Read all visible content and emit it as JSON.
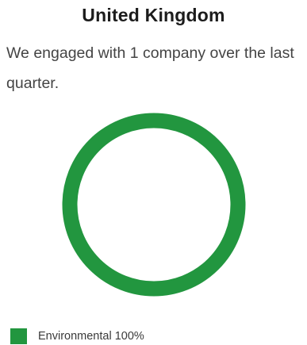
{
  "header": {
    "title": "United Kingdom",
    "subtitle": "We engaged with 1 company over the last quarter."
  },
  "colors": {
    "environmental": "#22963f"
  },
  "chart_data": {
    "type": "pie",
    "variant": "donut",
    "title": "United Kingdom",
    "categories": [
      "Environmental"
    ],
    "values": [
      100
    ],
    "labels": [
      "Environmental 100%"
    ],
    "colors": [
      "#22963f"
    ],
    "legend_position": "bottom-left"
  }
}
